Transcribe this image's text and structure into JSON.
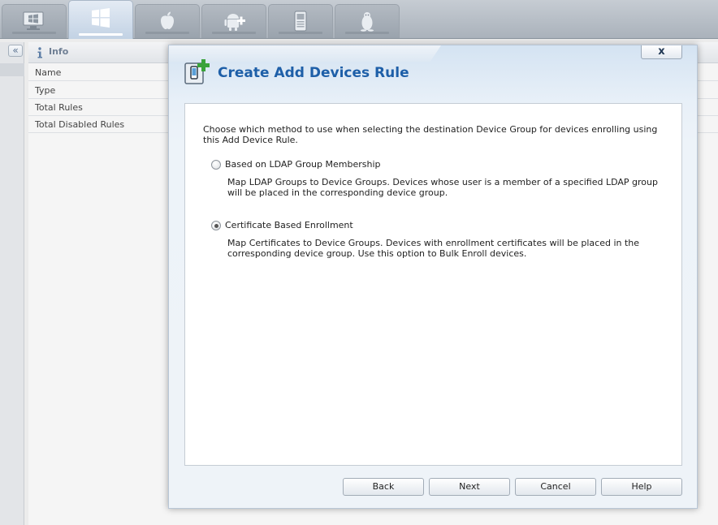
{
  "platform_tabs": [
    {
      "name": "windows-desktop",
      "icon": "windows-desktop-icon",
      "active": false
    },
    {
      "name": "windows",
      "icon": "windows-logo-icon",
      "active": true
    },
    {
      "name": "apple",
      "icon": "apple-logo-icon",
      "active": false
    },
    {
      "name": "android",
      "icon": "android-add-icon",
      "active": false
    },
    {
      "name": "device",
      "icon": "handheld-device-icon",
      "active": false
    },
    {
      "name": "linux",
      "icon": "linux-penguin-icon",
      "active": false
    }
  ],
  "collapse_glyph": "«",
  "info_panel": {
    "title": "Info",
    "rows": [
      "Name",
      "Type",
      "Total Rules",
      "Total Disabled Rules"
    ]
  },
  "dialog": {
    "title": "Create Add Devices Rule",
    "close_label": "x",
    "intro": "Choose which method to use when selecting the destination Device Group for devices enrolling using this Add Device Rule.",
    "options": [
      {
        "label": "Based on LDAP Group Membership",
        "description": "Map LDAP Groups to Device Groups. Devices whose user is a member of a specified LDAP group will be placed in the corresponding device group.",
        "checked": false
      },
      {
        "label": "Certificate Based Enrollment",
        "description": "Map Certificates to Device Groups. Devices with enrollment certificates will be placed in the corresponding device group. Use this option to Bulk Enroll devices.",
        "checked": true
      }
    ],
    "buttons": {
      "back": "Back",
      "next": "Next",
      "cancel": "Cancel",
      "help": "Help"
    }
  },
  "colors": {
    "title_blue": "#1e5fa8",
    "accent_green": "#3aa33a"
  }
}
